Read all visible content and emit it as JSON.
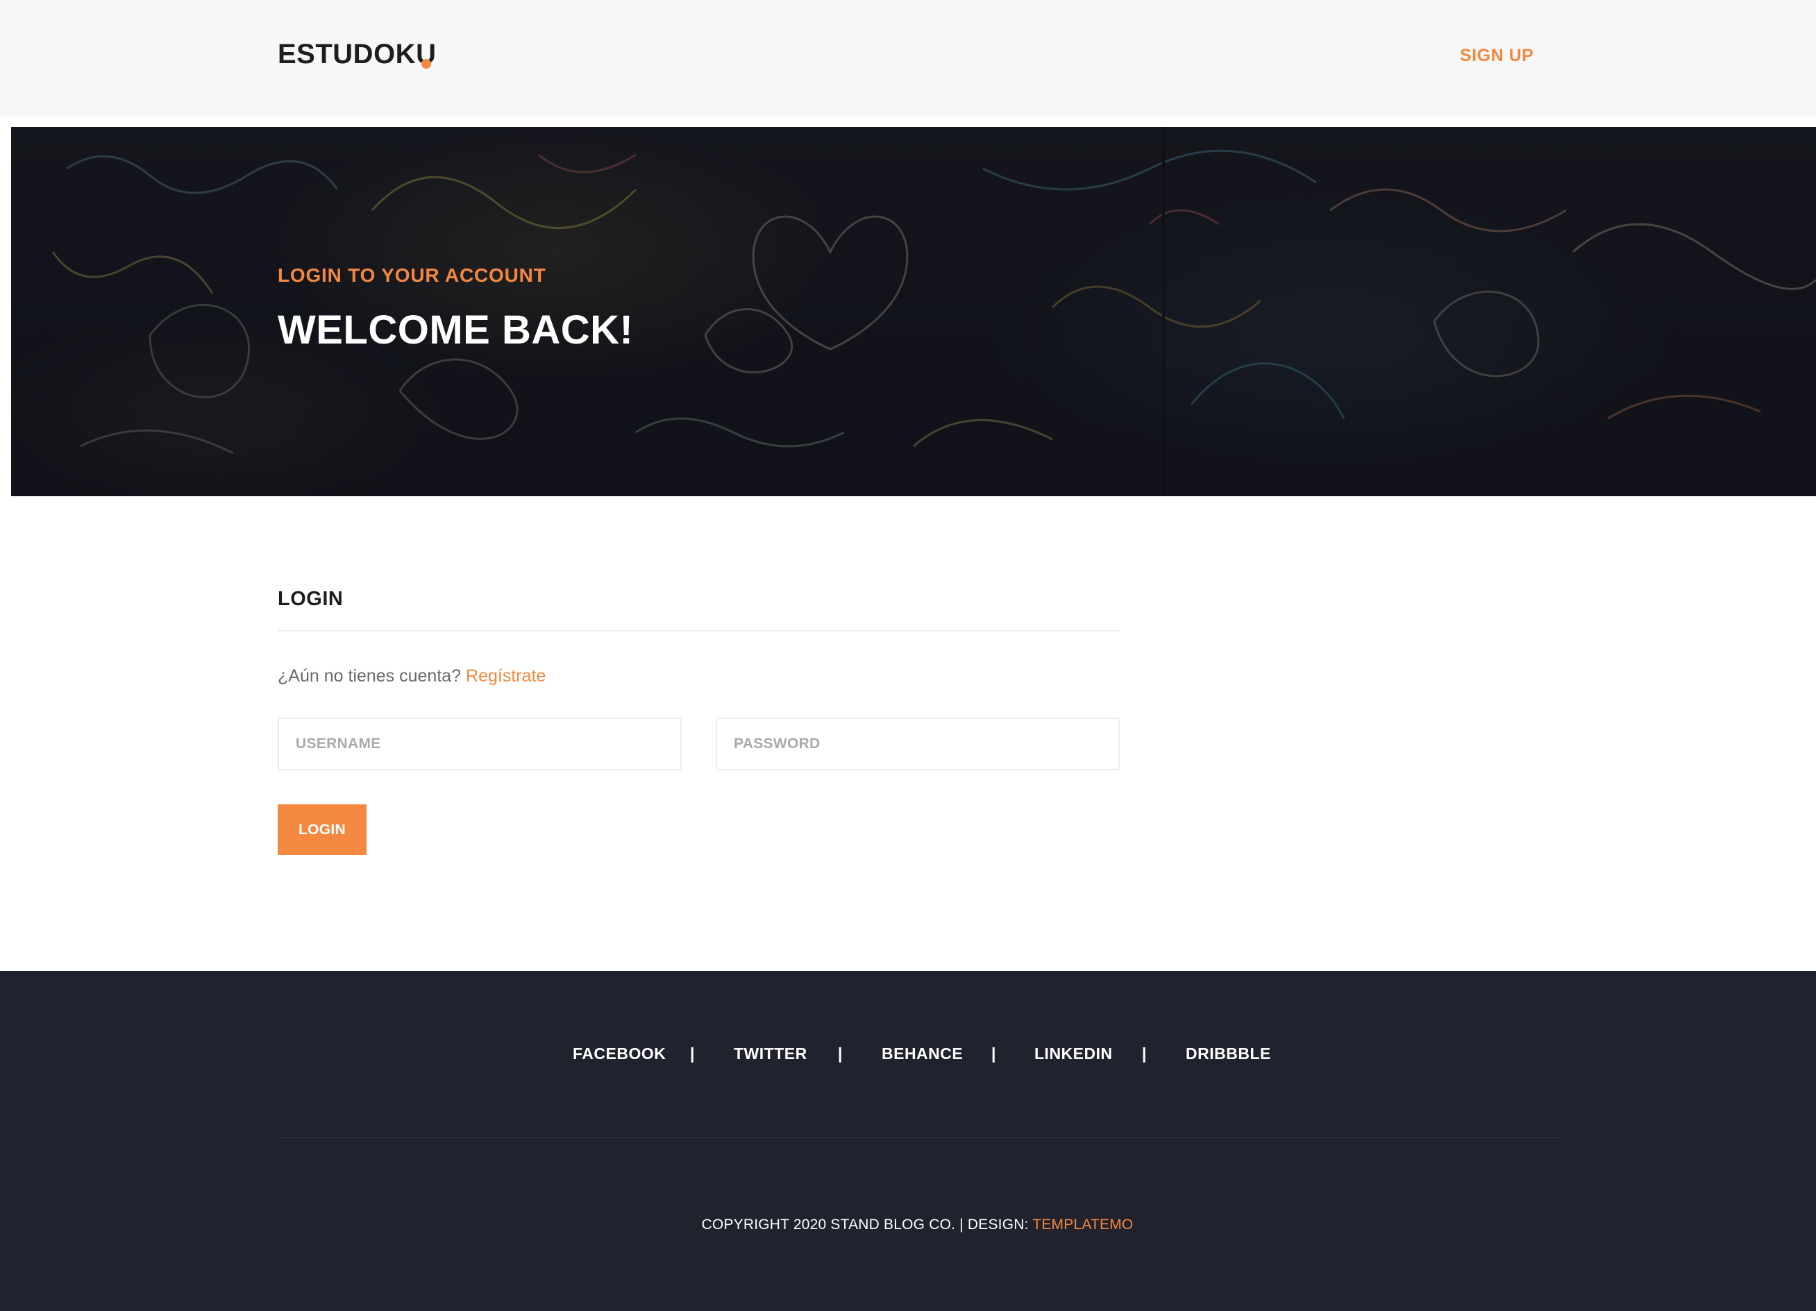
{
  "header": {
    "logo_text": "ESTUDOKU",
    "signup_label": "SIGN UP"
  },
  "hero": {
    "subtitle": "LOGIN TO YOUR ACCOUNT",
    "title": "WELCOME BACK!"
  },
  "login": {
    "heading": "LOGIN",
    "register_prompt": "¿Aún no tienes cuenta?",
    "register_link": "Regístrate",
    "username_placeholder": "USERNAME",
    "username_value": "",
    "password_placeholder": "PASSWORD",
    "password_value": "",
    "submit_label": "LOGIN"
  },
  "footer": {
    "social": [
      {
        "label": "FACEBOOK"
      },
      {
        "label": "TWITTER"
      },
      {
        "label": "BEHANCE"
      },
      {
        "label": "LINKEDIN"
      },
      {
        "label": "DRIBBBLE"
      }
    ],
    "separator": "|",
    "copyright_text": "COPYRIGHT 2020 STAND BLOG CO. | DESIGN:",
    "design_link": "TEMPLATEMO"
  },
  "colors": {
    "accent": "#f48840",
    "footer_bg": "#20232e",
    "header_bg": "#f7f7f7",
    "text_dark": "#1e1e1e"
  }
}
